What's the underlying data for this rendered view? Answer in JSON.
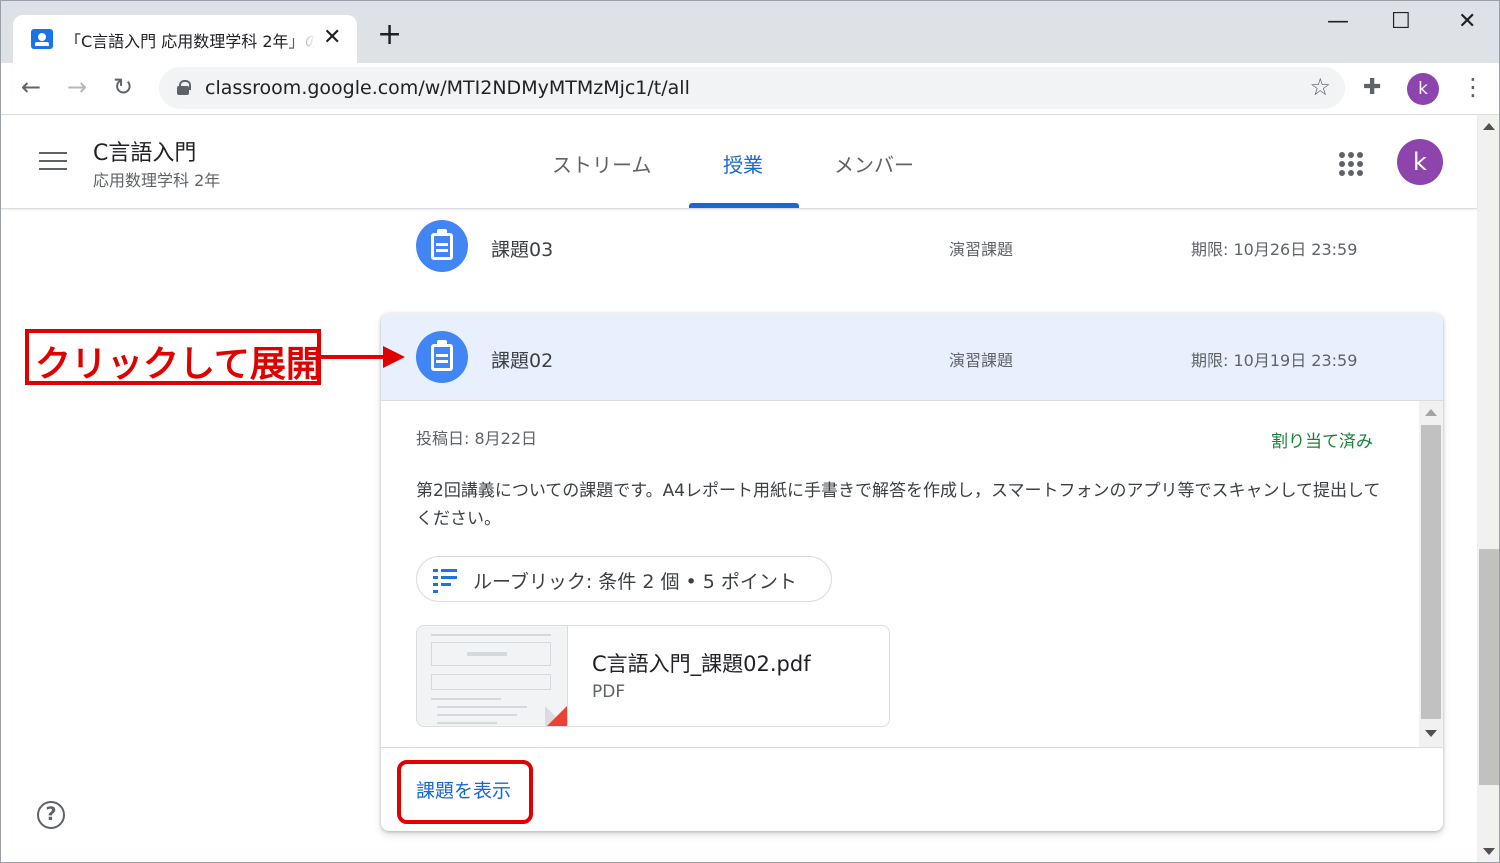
{
  "browser": {
    "tab_title": "「C言語入門 応用数理学科 2年」の",
    "tab_close": "✕",
    "new_tab": "+",
    "url": "classroom.google.com/w/MTI2NDMyMTMzMjc1/t/all",
    "profile_initial": "k",
    "window_controls": {
      "minimize": "—",
      "maximize": "☐",
      "close": "✕"
    },
    "nav": {
      "back": "←",
      "forward": "→",
      "reload": "↻",
      "star": "☆",
      "extensions": "✚",
      "menu": "⋮"
    }
  },
  "header": {
    "class_name": "C言語入門",
    "class_section": "応用数理学科 2年",
    "tabs": [
      {
        "label": "ストリーム",
        "active": false
      },
      {
        "label": "授業",
        "active": true
      },
      {
        "label": "メンバー",
        "active": false
      }
    ],
    "profile_initial": "k"
  },
  "assignments": [
    {
      "title": "課題03",
      "type": "演習課題",
      "due": "期限: 10月26日 23:59"
    },
    {
      "title": "課題02",
      "type": "演習課題",
      "due": "期限: 10月19日 23:59",
      "posted": "投稿日: 8月22日",
      "status": "割り当て済み",
      "description": "第2回講義についての課題です。A4レポート用紙に手書きで解答を作成し，スマートフォンのアプリ等でスキャンして提出してください。",
      "rubric": "ルーブリック: 条件 2 個 • 5 ポイント",
      "attachment": {
        "name": "C言語入門_課題02.pdf",
        "type": "PDF"
      },
      "view_link": "課題を表示"
    }
  ],
  "annotation": {
    "text": "クリックして展開"
  },
  "help": "?",
  "colors": {
    "accent": "#1967d2",
    "assignment_icon": "#4285f4",
    "annotation": "#e00000",
    "status": "#188038",
    "expanded_bg": "#e8f0fe"
  }
}
